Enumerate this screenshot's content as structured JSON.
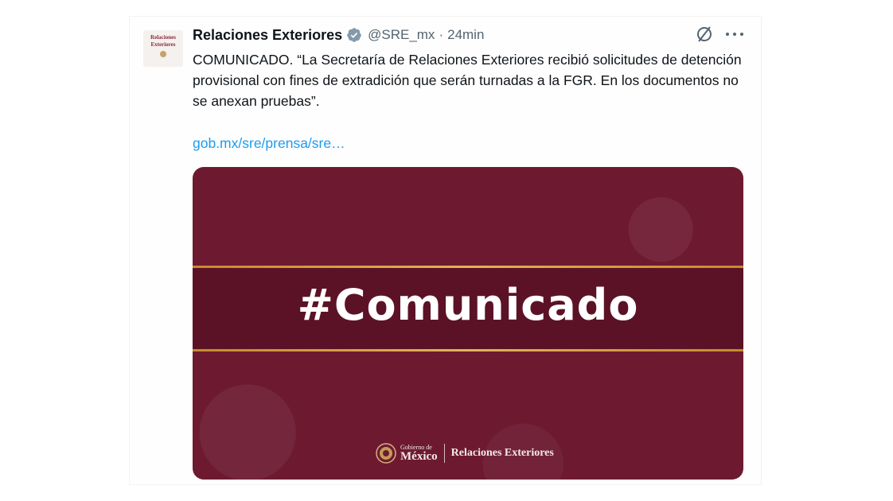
{
  "tweet": {
    "avatar": {
      "line1": "Relaciones",
      "line2": "Exteriores"
    },
    "author_name": "Relaciones Exteriores",
    "handle": "@SRE_mx",
    "separator": "·",
    "time": "24min",
    "text": "COMUNICADO. “La Secretaría de Relaciones Exteriores recibió solicitudes de detención provisional con fines de extradición que serán turnadas a la FGR. En los documentos no se anexan pruebas”.",
    "link": "gob.mx/sre/prensa/sre…",
    "card": {
      "hashtag": "#Comunicado",
      "gob_line1": "Gobierno de",
      "gob_line2": "México",
      "sre_label": "Relaciones Exteriores"
    }
  },
  "icons": {
    "verified": "verified-badge-icon",
    "grok": "grok-icon",
    "more": "more-icon"
  },
  "colors": {
    "link": "#1d9bf0",
    "card_bg": "#6d1a31",
    "gold": "#e2b457",
    "muted": "#536471"
  }
}
